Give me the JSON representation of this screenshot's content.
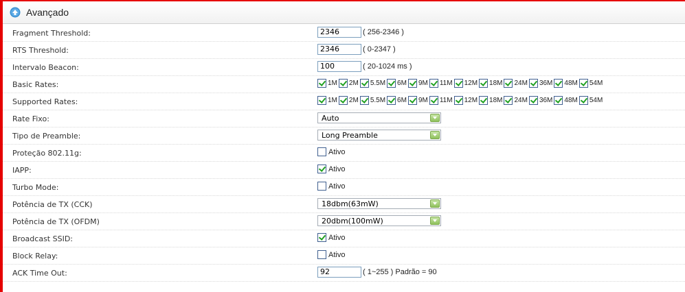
{
  "section": {
    "title": "Avançado",
    "icon": "arrow-up-circle-icon"
  },
  "fields": {
    "fragment_threshold": {
      "label": "Fragment Threshold:",
      "value": "2346",
      "hint": "( 256-2346 )"
    },
    "rts_threshold": {
      "label": "RTS Threshold:",
      "value": "2346",
      "hint": "( 0-2347 )"
    },
    "beacon_interval": {
      "label": "Intervalo Beacon:",
      "value": "100",
      "hint": "( 20-1024 ms )"
    },
    "basic_rates": {
      "label": "Basic Rates:",
      "rates": [
        "1M",
        "2M",
        "5.5M",
        "6M",
        "9M",
        "11M",
        "12M",
        "18M",
        "24M",
        "36M",
        "48M",
        "54M"
      ]
    },
    "supported_rates": {
      "label": "Supported Rates:",
      "rates": [
        "1M",
        "2M",
        "5.5M",
        "6M",
        "9M",
        "11M",
        "12M",
        "18M",
        "24M",
        "36M",
        "48M",
        "54M"
      ]
    },
    "rate_fixo": {
      "label": "Rate Fixo:",
      "selected": "Auto"
    },
    "preamble": {
      "label": "Tipo de Preamble:",
      "selected": "Long Preamble"
    },
    "protecao": {
      "label": "Proteção 802.11g:",
      "checked": false,
      "text": "Ativo"
    },
    "iapp": {
      "label": "IAPP:",
      "checked": true,
      "text": "Ativo"
    },
    "turbo": {
      "label": "Turbo Mode:",
      "checked": false,
      "text": "Ativo"
    },
    "tx_cck": {
      "label": "Potência de TX (CCK)",
      "selected": "18dbm(63mW)"
    },
    "tx_ofdm": {
      "label": "Potência de TX (OFDM)",
      "selected": "20dbm(100mW)"
    },
    "broadcast_ssid": {
      "label": "Broadcast SSID:",
      "checked": true,
      "text": "Ativo"
    },
    "block_relay": {
      "label": "Block Relay:",
      "checked": false,
      "text": "Ativo"
    },
    "ack_timeout": {
      "label": "ACK Time Out:",
      "value": "92",
      "hint": "( 1~255 ) Padrão = 90"
    }
  },
  "colors": {
    "accent_border": "#e60000",
    "check": "#21a121",
    "header_icon": "#3a8fd0"
  }
}
